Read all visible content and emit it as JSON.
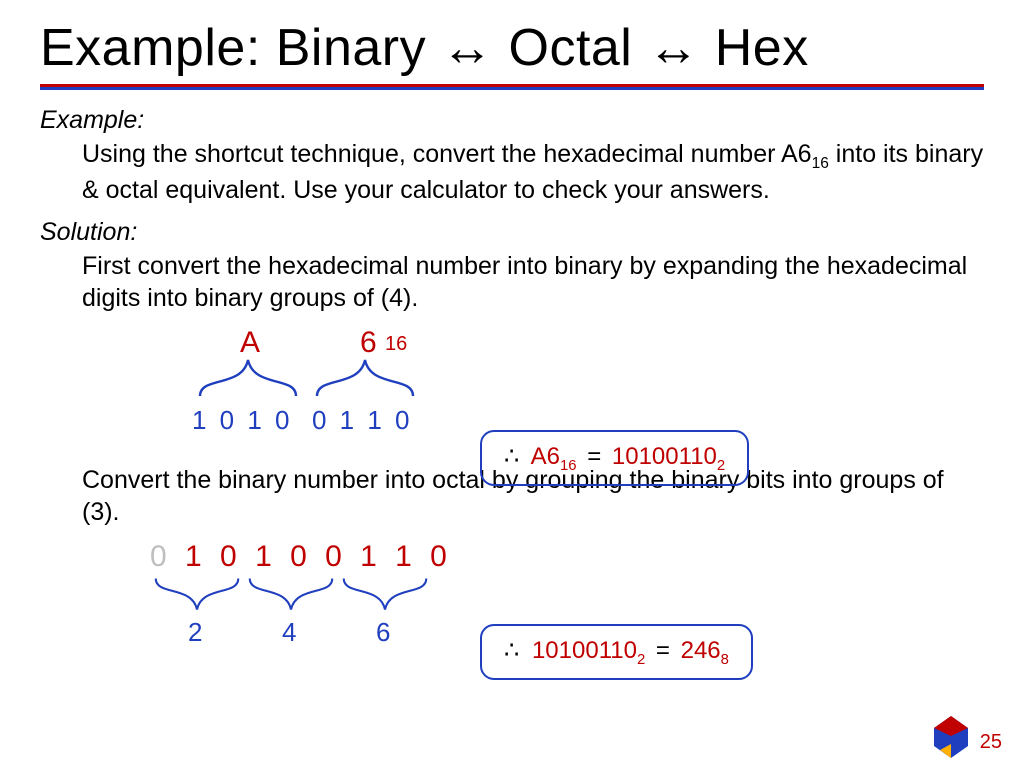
{
  "title": "Example: Binary ↔ Octal ↔ Hex",
  "example_label": "Example",
  "example_text_1": "Using the shortcut technique, convert the hexadecimal number A6",
  "example_sub_1": "16",
  "example_text_2": " into its binary & octal equivalent. Use your calculator to check your answers.",
  "solution_label": "Solution",
  "solution_text_1": "First convert the hexadecimal number into binary by expanding the hexadecimal digits into binary groups of (4).",
  "hex": {
    "A": "A",
    "six": "6",
    "sub": "16"
  },
  "bits_group_A": "1 0 1 0",
  "bits_group_6": "0 1 1 0",
  "result1": {
    "therefore": "∴",
    "lhs": "A6",
    "lhs_sub": "16",
    "eq": "=",
    "rhs": "10100110",
    "rhs_sub": "2"
  },
  "solution_text_2": "Convert the binary number into octal by grouping the binary bits into groups of (3).",
  "bits2_pad": "0",
  "bits2_rest": "1 0 1 0 0 1 1 0",
  "oct": {
    "a": "2",
    "b": "4",
    "c": "6"
  },
  "result2": {
    "therefore": "∴",
    "lhs": "10100110",
    "lhs_sub": "2",
    "eq": "=",
    "rhs": "246",
    "rhs_sub": "8"
  },
  "page_number": "25"
}
